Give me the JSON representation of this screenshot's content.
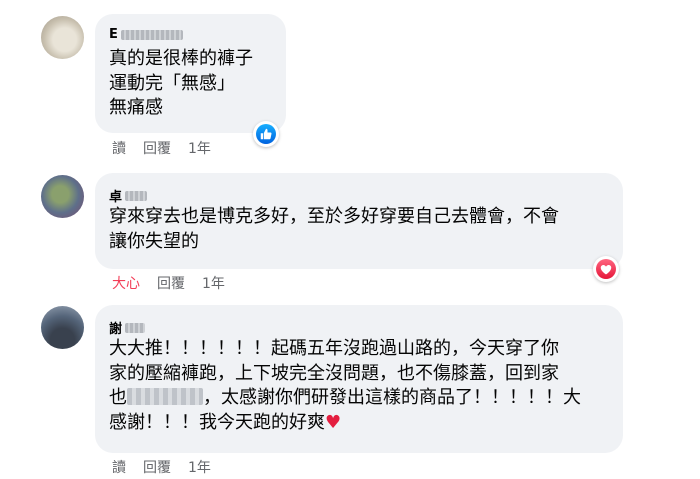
{
  "comments": [
    {
      "author": "E",
      "author_blurred_suffix": true,
      "lines": [
        "真的是很棒的褲子",
        "運動完「無感」",
        "無痛感"
      ],
      "reaction": "like-icon",
      "actions": {
        "reply_label": "讀",
        "reply2_label": "回覆",
        "time": "1年"
      }
    },
    {
      "author": "卓",
      "lines": [
        "穿來穿去也是博克多好，至於多好穿要自己去體會，不會",
        "讓你失望的"
      ],
      "reaction": "love-icon",
      "actions": {
        "reaction_label": "大心",
        "reply2_label": "回覆",
        "time": "1年"
      }
    },
    {
      "author": "謝",
      "lines": [
        "大大推！！！！！！起碼五年沒跑過山路的，今天穿了你",
        "家的壓縮褲跑，上下坡完全沒問題，也不傷膝蓋，回到家",
        "，太感謝你們研發出這樣的商品了！！！！！大",
        "感謝！！！我今天跑的好爽"
      ],
      "line3_prefix": "也",
      "actions": {
        "reply_label": "讀",
        "reply2_label": "回覆",
        "time": "1年"
      }
    }
  ],
  "colors": {
    "bubble": "#f0f2f5",
    "action_text": "#65676b",
    "love": "#f33e58",
    "like": "#1877f2"
  }
}
